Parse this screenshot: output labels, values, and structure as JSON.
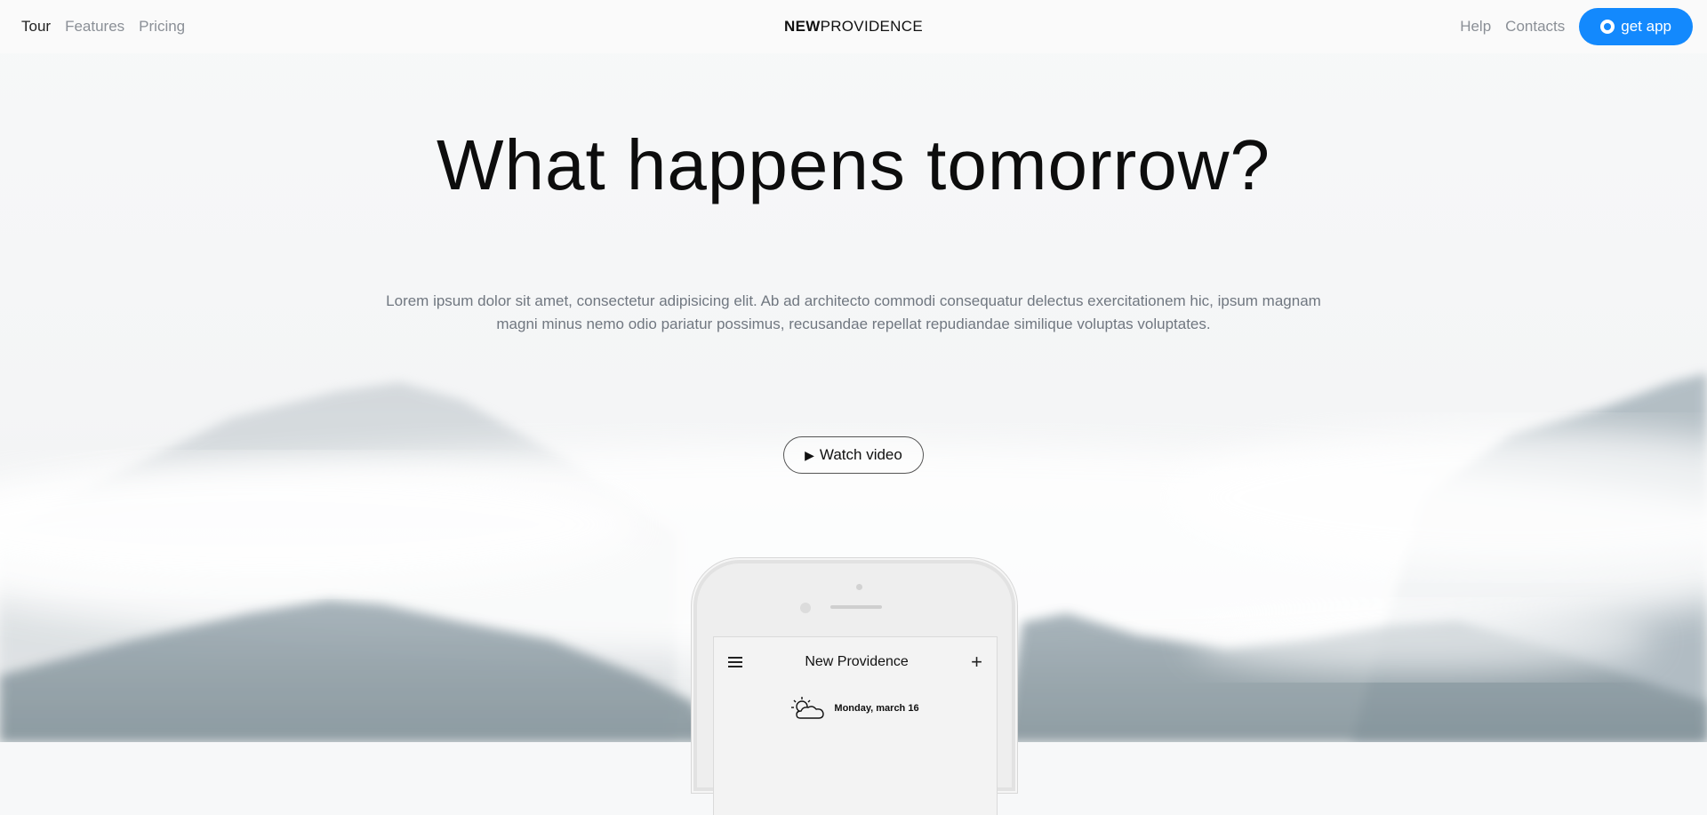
{
  "nav": {
    "left": [
      "Tour",
      "Features",
      "Pricing"
    ],
    "brand_bold": "NEW",
    "brand_rest": "PROVIDENCE",
    "right": [
      "Help",
      "Contacts"
    ],
    "cta_label": "get app",
    "cta_icon": "github-icon"
  },
  "hero": {
    "title": "What happens tomorrow?",
    "lead": "Lorem ipsum dolor sit amet, consectetur adipisicing elit. Ab ad architecto commodi consequatur delectus exercitationem hic, ipsum magnam magni minus nemo odio pariatur possimus, recusandae repellat repudiandae similique voluptas voluptates.",
    "watch_icon": "play-icon",
    "watch_label": "Watch video"
  },
  "phone": {
    "app_title": "New Providence",
    "menu_icon": "hamburger-icon",
    "add_icon": "plus-icon",
    "weather_icon": "partly-cloudy-icon",
    "date": "Monday, march 16"
  },
  "colors": {
    "accent": "#1389fd",
    "text_dark": "#0d0d0d",
    "text_muted": "#707780",
    "nav_muted": "#8a8f96"
  }
}
